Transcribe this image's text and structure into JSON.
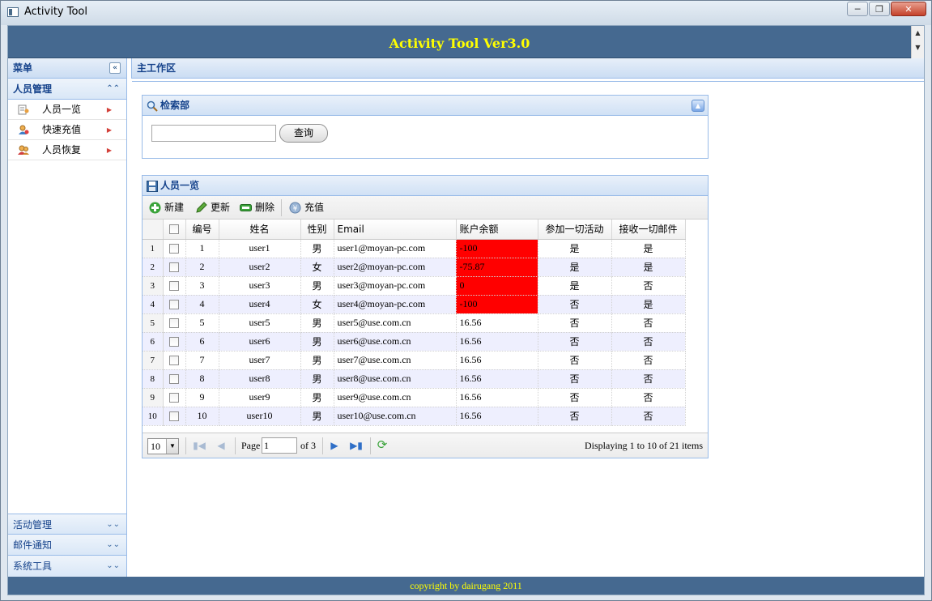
{
  "window": {
    "title": "Activity Tool"
  },
  "header": {
    "title": "Activity Tool Ver3.0"
  },
  "sidebar": {
    "title": "菜单",
    "active_group": "人员管理",
    "items": [
      {
        "label": "人员一览",
        "icon": "user-list-icon"
      },
      {
        "label": "快速充值",
        "icon": "user-charge-icon"
      },
      {
        "label": "人员恢复",
        "icon": "user-restore-icon"
      }
    ],
    "groups": [
      "活动管理",
      "邮件通知",
      "系统工具"
    ]
  },
  "main": {
    "title": "主工作区"
  },
  "search": {
    "title": "检索部",
    "value": "",
    "button_label": "查询"
  },
  "grid": {
    "title": "人员一览",
    "toolbar": {
      "new": "新建",
      "update": "更新",
      "delete": "删除",
      "charge": "充值"
    },
    "columns": [
      "编号",
      "姓名",
      "性别",
      "Email",
      "账户余额",
      "参加一切活动",
      "接收一切邮件"
    ],
    "rows": [
      {
        "rn": "1",
        "id": "1",
        "name": "user1",
        "gender": "男",
        "email": "user1@moyan-pc.com",
        "balance": "-100",
        "join_all": "是",
        "receive_all": "是",
        "negative": true
      },
      {
        "rn": "2",
        "id": "2",
        "name": "user2",
        "gender": "女",
        "email": "user2@moyan-pc.com",
        "balance": "-75.87",
        "join_all": "是",
        "receive_all": "是",
        "negative": true
      },
      {
        "rn": "3",
        "id": "3",
        "name": "user3",
        "gender": "男",
        "email": "user3@moyan-pc.com",
        "balance": "0",
        "join_all": "是",
        "receive_all": "否",
        "negative": true
      },
      {
        "rn": "4",
        "id": "4",
        "name": "user4",
        "gender": "女",
        "email": "user4@moyan-pc.com",
        "balance": "-100",
        "join_all": "否",
        "receive_all": "是",
        "negative": true
      },
      {
        "rn": "5",
        "id": "5",
        "name": "user5",
        "gender": "男",
        "email": "user5@use.com.cn",
        "balance": "16.56",
        "join_all": "否",
        "receive_all": "否",
        "negative": false
      },
      {
        "rn": "6",
        "id": "6",
        "name": "user6",
        "gender": "男",
        "email": "user6@use.com.cn",
        "balance": "16.56",
        "join_all": "否",
        "receive_all": "否",
        "negative": false
      },
      {
        "rn": "7",
        "id": "7",
        "name": "user7",
        "gender": "男",
        "email": "user7@use.com.cn",
        "balance": "16.56",
        "join_all": "否",
        "receive_all": "否",
        "negative": false
      },
      {
        "rn": "8",
        "id": "8",
        "name": "user8",
        "gender": "男",
        "email": "user8@use.com.cn",
        "balance": "16.56",
        "join_all": "否",
        "receive_all": "否",
        "negative": false
      },
      {
        "rn": "9",
        "id": "9",
        "name": "user9",
        "gender": "男",
        "email": "user9@use.com.cn",
        "balance": "16.56",
        "join_all": "否",
        "receive_all": "否",
        "negative": false
      },
      {
        "rn": "10",
        "id": "10",
        "name": "user10",
        "gender": "男",
        "email": "user10@use.com.cn",
        "balance": "16.56",
        "join_all": "否",
        "receive_all": "否",
        "negative": false
      }
    ]
  },
  "pager": {
    "page_size": "10",
    "page_label": "Page",
    "page_value": "1",
    "of_label": "of 3",
    "display_text": "Displaying 1 to 10 of 21 items"
  },
  "footer": {
    "text": "copyright by dairugang 2011"
  },
  "colors": {
    "header_bg": "#456990",
    "header_text": "#ffff00",
    "negative_balance": "#ff0000",
    "panel_title": "#15428b"
  }
}
